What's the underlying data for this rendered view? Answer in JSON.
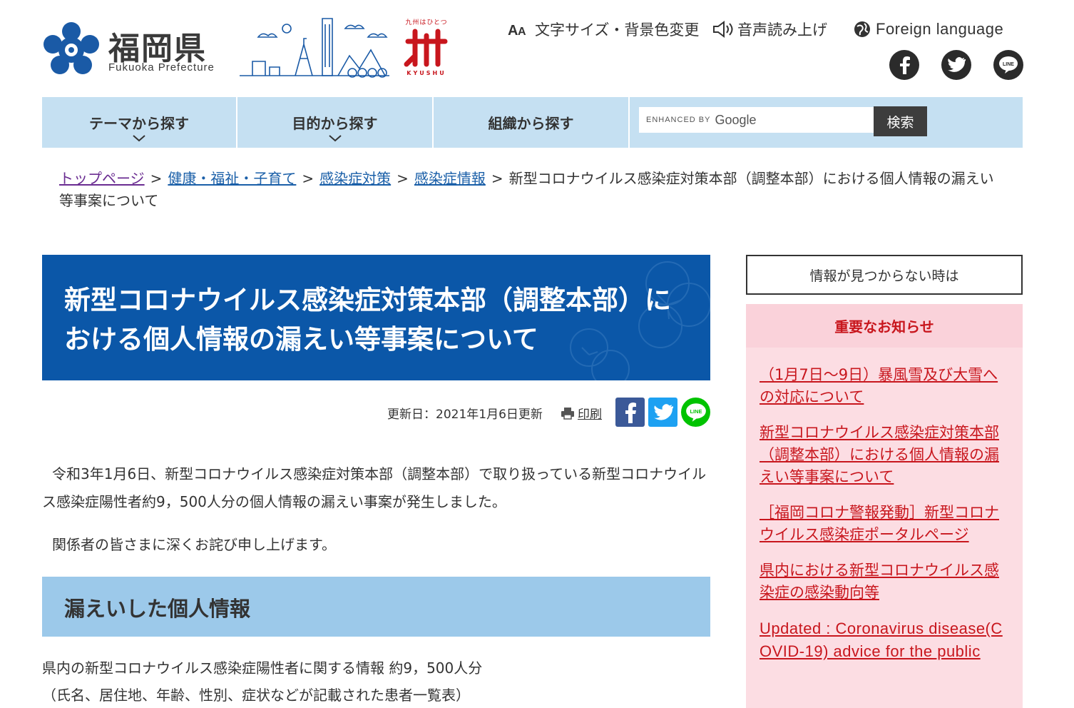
{
  "header": {
    "logo": {
      "name_jp": "福岡県",
      "name_en": "Fukuoka Prefecture"
    },
    "kyushu_logo": {
      "top": "九州はひとつ",
      "mark": "卅",
      "bottom": "KYUSHU"
    },
    "utility": {
      "font_size_label": "文字サイズ・背景色変更",
      "voice_label": "音声読み上げ",
      "language_label": "Foreign language"
    },
    "social": {
      "facebook": "facebook",
      "twitter": "twitter",
      "line": "LINE"
    }
  },
  "nav": {
    "items": [
      {
        "label": "テーマから探す",
        "has_dropdown": true
      },
      {
        "label": "目的から探す",
        "has_dropdown": true
      },
      {
        "label": "組織から探す",
        "has_dropdown": false
      }
    ],
    "search": {
      "enhanced_by": "ENHANCED BY",
      "google": "Google",
      "button": "検索"
    }
  },
  "breadcrumb": {
    "links": [
      "トップページ",
      "健康・福祉・子育て",
      "感染症対策",
      "感染症情報"
    ],
    "separator": ">",
    "current": "新型コロナウイルス感染症対策本部（調整本部）における個人情報の漏えい等事案について"
  },
  "main": {
    "title": "新型コロナウイルス感染症対策本部（調整本部）における個人情報の漏えい等事案について",
    "updated": "更新日：2021年1月6日更新",
    "print_label": "印刷",
    "share_line": "LINE",
    "paragraph1": "令和3年1月6日、新型コロナウイルス感染症対策本部（調整本部）で取り扱っている新型コロナウイルス感染症陽性者約9，500人分の個人情報の漏えい事案が発生しました。",
    "paragraph2": "関係者の皆さまに深くお詫び申し上げます。",
    "section_heading": "漏えいした個人情報",
    "info_line1": "県内の新型コロナウイルス感染症陽性者に関する情報 約9，500人分",
    "info_line2": "（氏名、居住地、年齢、性別、症状などが記載された患者一覧表）"
  },
  "sidebar": {
    "not_found": "情報が見つからない時は",
    "notice_heading": "重要なお知らせ",
    "notices": [
      "（1月7日～9日）暴風雪及び大雪への対応について",
      "新型コロナウイルス感染症対策本部（調整本部）における個人情報の漏えい等事案について",
      "［福岡コロナ警報発動］新型コロナウイルス感染症ポータルページ",
      "県内における新型コロナウイルス感染症の感染動向等",
      "Updated : Coronavirus disease(COVID-19) advice for the public"
    ]
  },
  "colors": {
    "title_bg": "#0b57a8",
    "nav_bg": "#c5e0f2",
    "section_bg": "#9cc9ea",
    "notice_bg": "#fcdde3",
    "notice_text": "#c8161d",
    "link": "#1a5fa8"
  }
}
